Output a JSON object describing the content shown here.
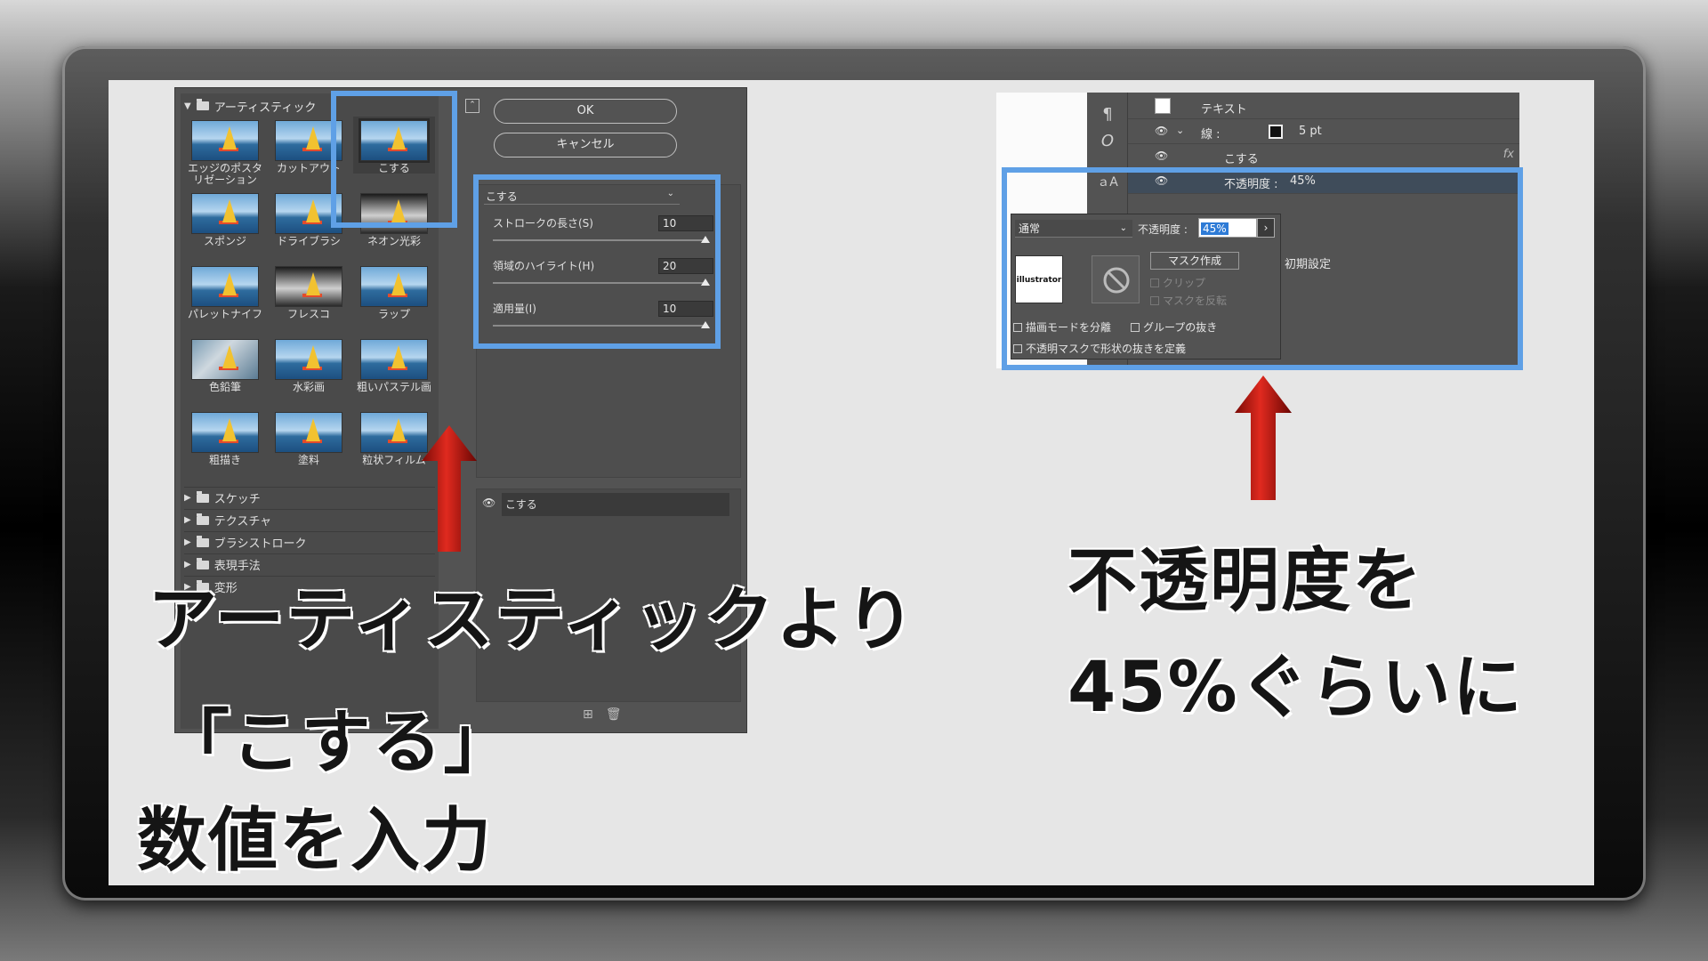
{
  "filter_gallery": {
    "category_open": "アーティスティック",
    "thumbnails": [
      {
        "label": "エッジのポスタリゼーション"
      },
      {
        "label": "カットアウト"
      },
      {
        "label": "こする"
      },
      {
        "label": "スポンジ"
      },
      {
        "label": "ドライブラシ"
      },
      {
        "label": "ネオン光彩"
      },
      {
        "label": "パレットナイフ"
      },
      {
        "label": "フレスコ"
      },
      {
        "label": "ラップ"
      },
      {
        "label": "色鉛筆"
      },
      {
        "label": "水彩画"
      },
      {
        "label": "粗いパステル画"
      },
      {
        "label": "粗描き"
      },
      {
        "label": "塗料"
      },
      {
        "label": "粒状フィルム"
      }
    ],
    "categories_closed": [
      "スケッチ",
      "テクスチャ",
      "ブラシストローク",
      "表現手法",
      "変形"
    ],
    "ok_label": "OK",
    "cancel_label": "キャンセル",
    "filter_select": "こする",
    "params": [
      {
        "name": "ストロークの長さ(S)",
        "value": "10"
      },
      {
        "name": "領域のハイライト(H)",
        "value": "20"
      },
      {
        "name": "適用量(I)",
        "value": "10"
      }
    ],
    "layer_name": "こする"
  },
  "appearance": {
    "rows": {
      "text": "テキスト",
      "stroke_label": "線 :",
      "stroke_value": "5 pt",
      "effect": "こする",
      "opacity_label": "不透明度 :",
      "opacity_value": "45%",
      "default_label": "初期設定"
    },
    "popup": {
      "blend_mode": "通常",
      "opacity_label": "不透明度 :",
      "opacity_value": "45%",
      "thumb_text": "illustrator",
      "mask_button": "マスク作成",
      "clip": "クリップ",
      "invert_mask": "マスクを反転",
      "isolate_blending": "描画モードを分離",
      "knockout_group": "グループの抜き",
      "opacity_mask_define": "不透明マスクで形状の抜きを定義"
    },
    "fx_icon": "fx"
  },
  "captions": {
    "left_line1": "アーティスティックより",
    "left_line2": "「こする」",
    "left_line3": "数値を入力",
    "right_line1": "不透明度を",
    "right_line2": "45%ぐらいに"
  },
  "colors": {
    "highlight": "#5fa0e6",
    "arrow_red": "#c0160f",
    "panel_gray": "#535353"
  }
}
